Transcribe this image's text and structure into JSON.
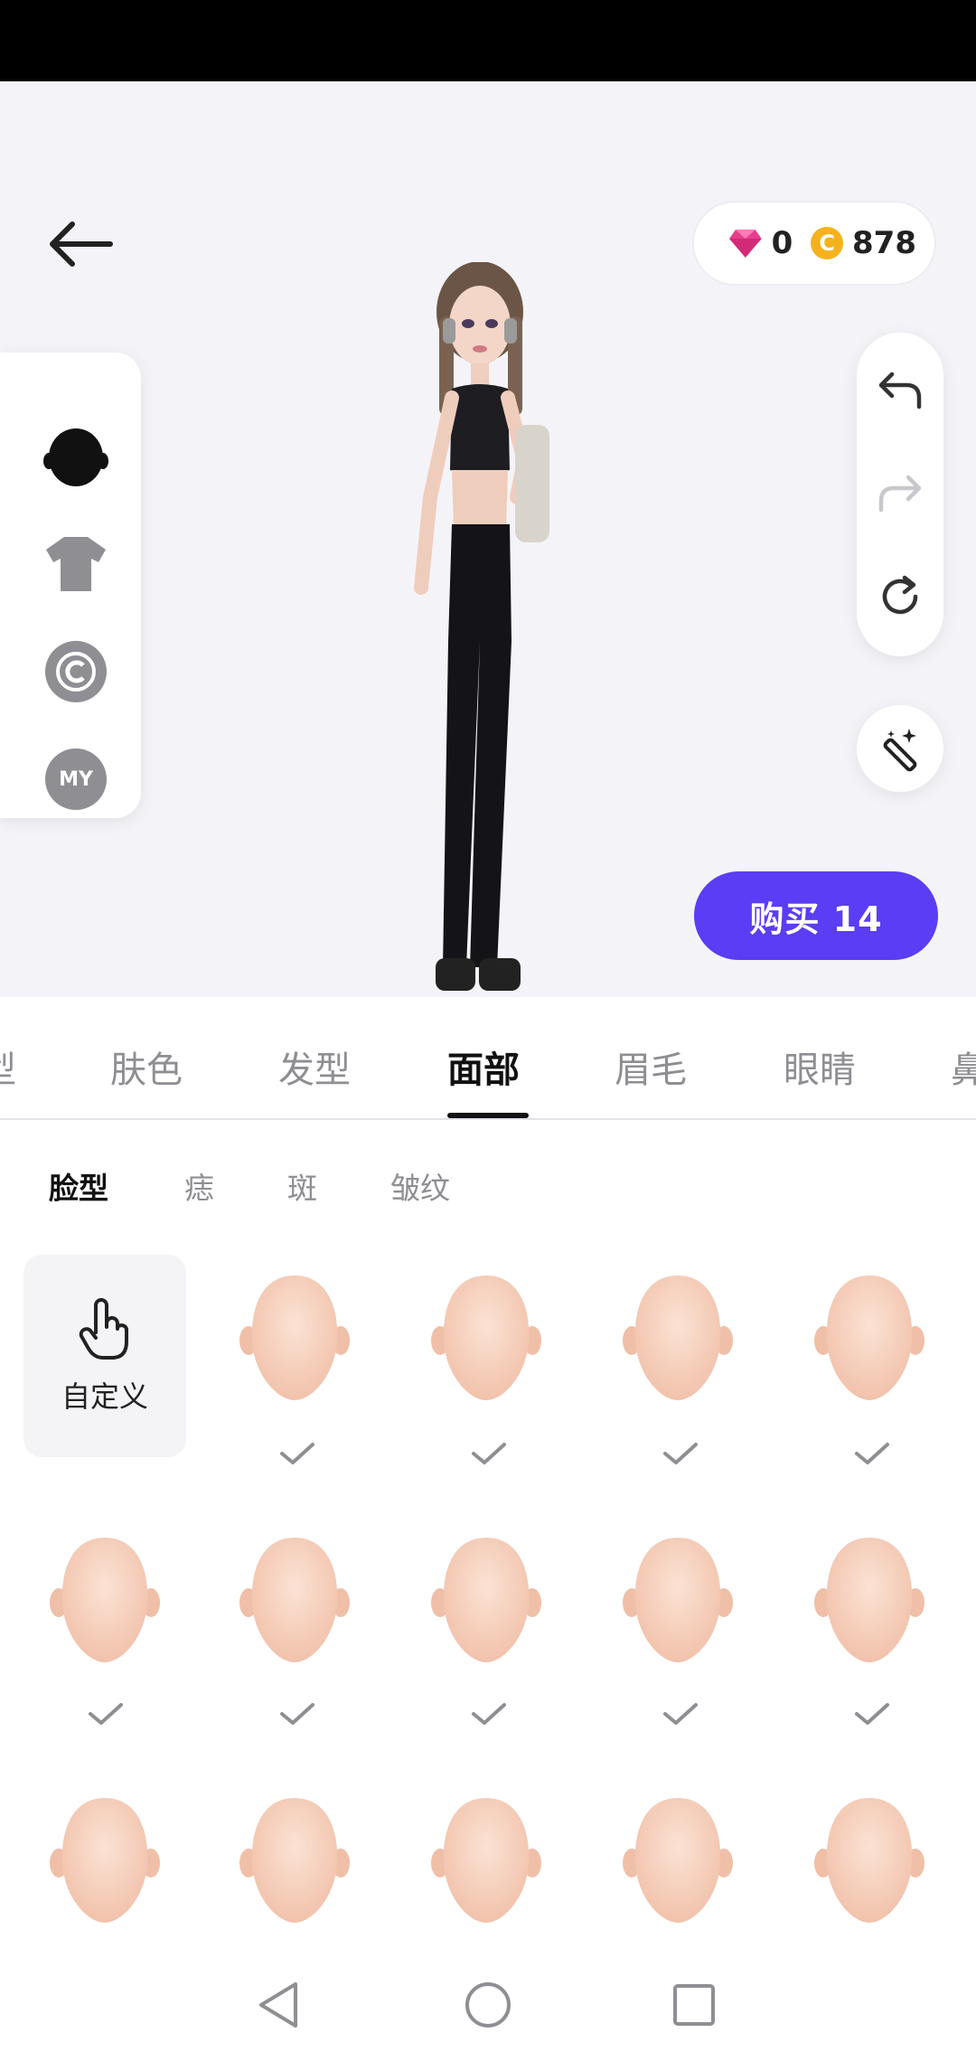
{
  "currency": {
    "gems": "0",
    "coin_symbol": "C",
    "coins": "878"
  },
  "buy_button": {
    "label": "购买 14"
  },
  "left_panel": {
    "items": [
      {
        "icon": "head-icon"
      },
      {
        "icon": "shirt-icon"
      },
      {
        "icon": "copyright-icon"
      },
      {
        "icon": "my-badge-icon",
        "label": "MY"
      }
    ]
  },
  "tabs": [
    {
      "label": "型"
    },
    {
      "label": "肤色"
    },
    {
      "label": "发型"
    },
    {
      "label": "面部",
      "active": true
    },
    {
      "label": "眉毛"
    },
    {
      "label": "眼睛"
    },
    {
      "label": "鼻"
    }
  ],
  "subtabs": [
    {
      "label": "脸型",
      "active": true
    },
    {
      "label": "痣"
    },
    {
      "label": "斑"
    },
    {
      "label": "皱纹"
    }
  ],
  "custom_tile": {
    "label": "自定义"
  },
  "colors": {
    "accent": "#5b3df5",
    "gem": "#e83e8c",
    "coin": "#f5b21c",
    "skin": "#f8d2c0"
  }
}
